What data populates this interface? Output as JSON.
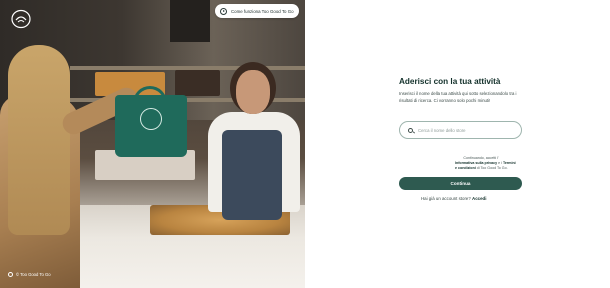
{
  "app": {
    "brand_logo_icon": "too-good-to-go-logo-icon",
    "accent_color": "#2e5a50"
  },
  "how_it_works": {
    "label": "Come funziona Too Good To Go",
    "icon": "play-circle-icon"
  },
  "photo": {
    "caption": "© Too Good To Go",
    "caption_icon": "brand-mark-icon"
  },
  "form": {
    "title": "Aderisci con la tua attività",
    "description": "Inserisci il nome della tua attività qui sotto selezionandolo tra i risultati di ricerca. Ci vorranno solo pochi minuti!",
    "search": {
      "placeholder": "Cerca il nome dello store",
      "value": "",
      "icon": "search-icon"
    },
    "terms": {
      "prefix": "Continuando, accetti l'",
      "privacy_link": "Informativa sulla privacy",
      "connector": " e i ",
      "tos_link": "Termini e condizioni",
      "suffix": " di Too Good To Go."
    },
    "continue_button": "Continua",
    "login_prompt": "Hai già un account store?",
    "login_link": "Accedi"
  }
}
